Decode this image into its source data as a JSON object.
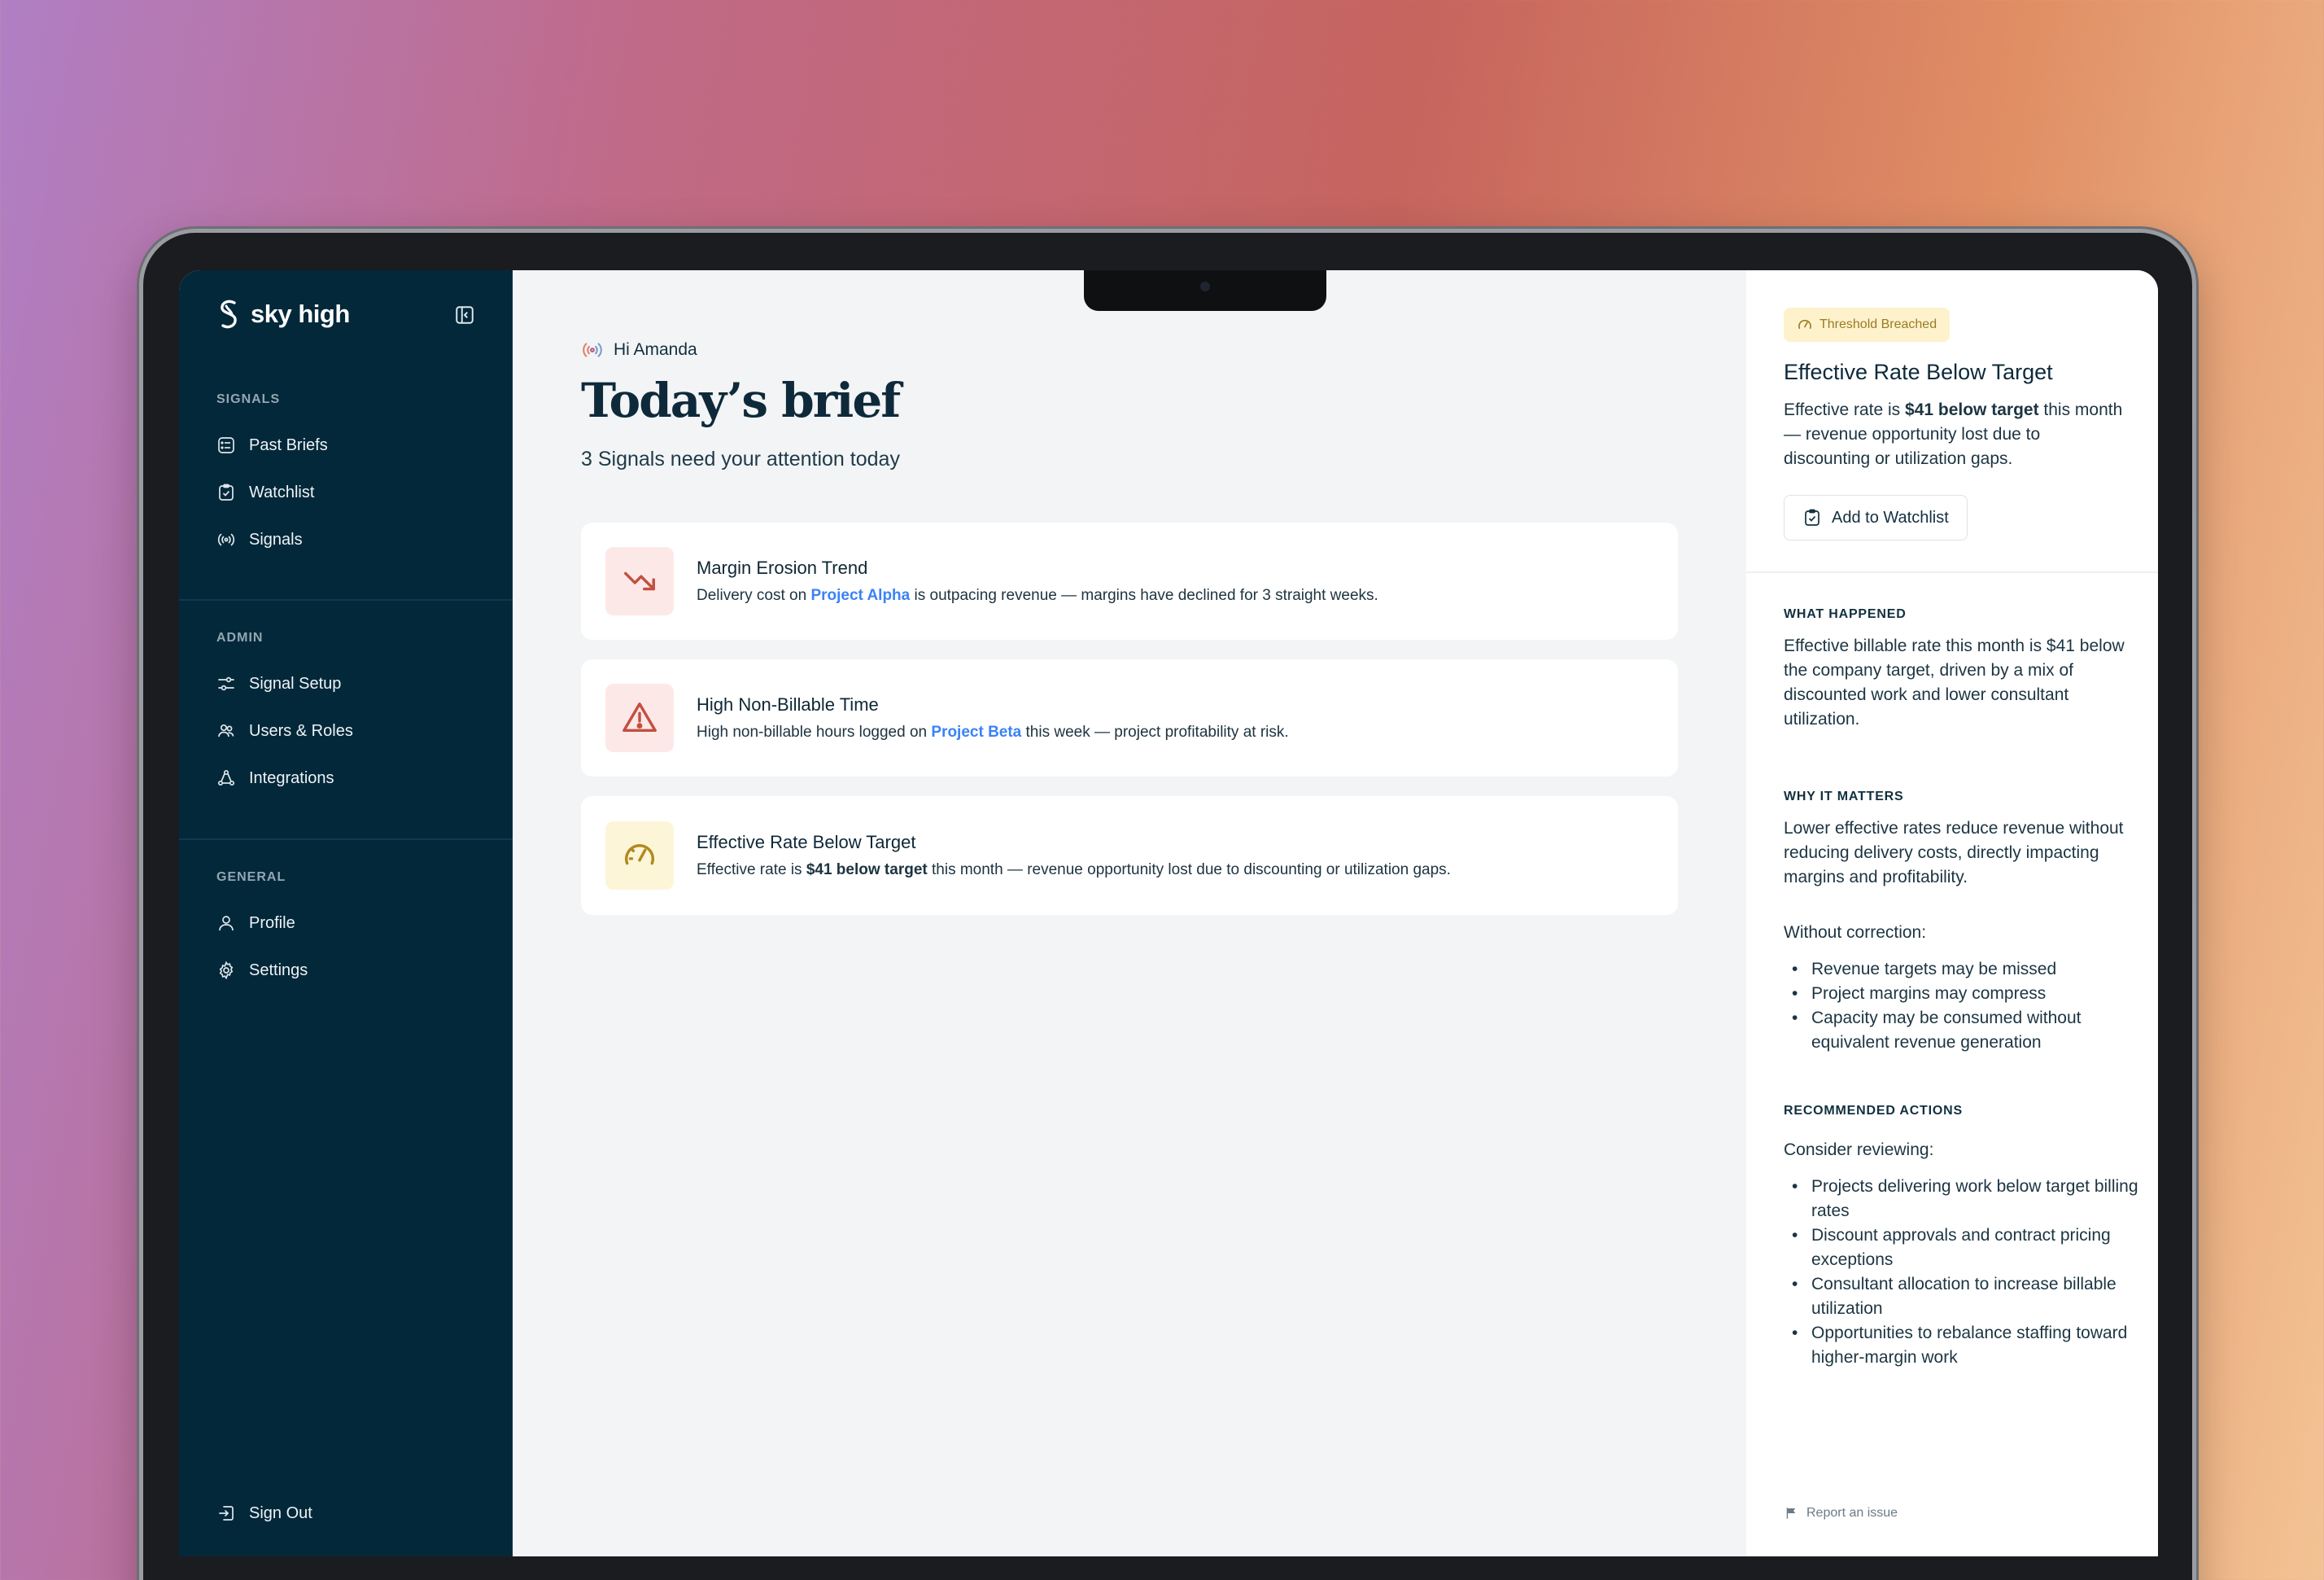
{
  "brand": {
    "name": "sky high"
  },
  "sidebar": {
    "sections": [
      {
        "title": "SIGNALS",
        "items": [
          {
            "label": "Past Briefs",
            "icon": "list-icon"
          },
          {
            "label": "Watchlist",
            "icon": "clipboard-check-icon"
          },
          {
            "label": "Signals",
            "icon": "broadcast-icon"
          }
        ]
      },
      {
        "title": "ADMIN",
        "items": [
          {
            "label": "Signal Setup",
            "icon": "sliders-icon"
          },
          {
            "label": "Users & Roles",
            "icon": "users-icon"
          },
          {
            "label": "Integrations",
            "icon": "integration-icon"
          }
        ]
      },
      {
        "title": "GENERAL",
        "items": [
          {
            "label": "Profile",
            "icon": "user-icon"
          },
          {
            "label": "Settings",
            "icon": "gear-icon"
          }
        ]
      }
    ],
    "sign_out": "Sign Out"
  },
  "main": {
    "greeting": "Hi Amanda",
    "title": "Today’s brief",
    "subtitle": "3 Signals need your attention today",
    "cards": [
      {
        "title": "Margin Erosion Trend",
        "desc_pre": "Delivery cost on ",
        "link": "Project Alpha",
        "desc_post": " is outpacing revenue — margins have declined for 3 straight weeks.",
        "icon": "trend-down-icon",
        "icon_bg": "#fde8e8",
        "icon_color": "#c2503f"
      },
      {
        "title": "High Non-Billable Time",
        "desc_pre": "High non-billable hours logged on ",
        "link": "Project Beta",
        "desc_post": " this week — project profitability at risk.",
        "icon": "warning-icon",
        "icon_bg": "#fde8e8",
        "icon_color": "#c2503f"
      },
      {
        "title": "Effective Rate Below Target",
        "desc_pre": "Effective rate is ",
        "bold": "$41 below target",
        "desc_post": " this month — revenue opportunity lost due to discounting or utilization gaps.",
        "icon": "gauge-icon",
        "icon_bg": "#fdf5d8",
        "icon_color": "#b08a1e"
      }
    ]
  },
  "panel": {
    "badge": "Threshold Breached",
    "title": "Effective Rate Below Target",
    "desc_pre": "Effective rate is ",
    "desc_bold": "$41 below target",
    "desc_post": " this month — revenue opportunity lost due to discounting or utilization gaps.",
    "watch_button": "Add to Watchlist",
    "what_happened": {
      "heading": "WHAT HAPPENED",
      "text": "Effective billable rate this month is $41 below the company target, driven by a mix of discounted work and lower consultant utilization."
    },
    "why_it_matters": {
      "heading": "WHY IT MATTERS",
      "text": "Lower effective rates reduce revenue without reducing delivery costs, directly impacting margins and profitability.",
      "lead": "Without correction:",
      "bullets": [
        "Revenue targets may be missed",
        "Project margins may compress",
        "Capacity may be consumed without equivalent revenue generation"
      ]
    },
    "recommended": {
      "heading": "RECOMMENDED ACTIONS",
      "lead": "Consider reviewing:",
      "bullets": [
        "Projects delivering work below target billing rates",
        "Discount approvals and contract pricing exceptions",
        "Consultant allocation to increase billable utilization",
        "Opportunities to rebalance staffing toward higher-margin work"
      ]
    },
    "report": "Report an issue"
  },
  "colors": {
    "sidebar": "#03283a",
    "accent_link": "#3b82f6",
    "badge_bg": "#fdf2cc"
  }
}
